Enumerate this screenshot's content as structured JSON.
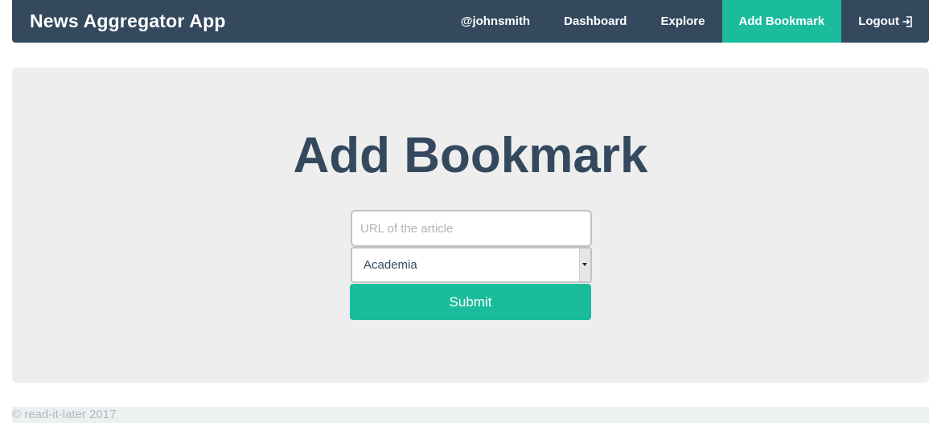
{
  "navbar": {
    "brand": "News Aggregator App",
    "items": [
      {
        "label": "@johnsmith"
      },
      {
        "label": "Dashboard"
      },
      {
        "label": "Explore"
      },
      {
        "label": "Add Bookmark",
        "active": true
      },
      {
        "label": "Logout",
        "icon": "logout-icon"
      }
    ]
  },
  "main": {
    "title": "Add Bookmark",
    "url_placeholder": "URL of the article",
    "category_selected": "Academia",
    "submit_label": "Submit"
  },
  "footer": {
    "text": "© read-it-later 2017"
  },
  "colors": {
    "navbar": "#34495e",
    "accent": "#1abc9c",
    "jumbotron": "#eeeeee"
  }
}
